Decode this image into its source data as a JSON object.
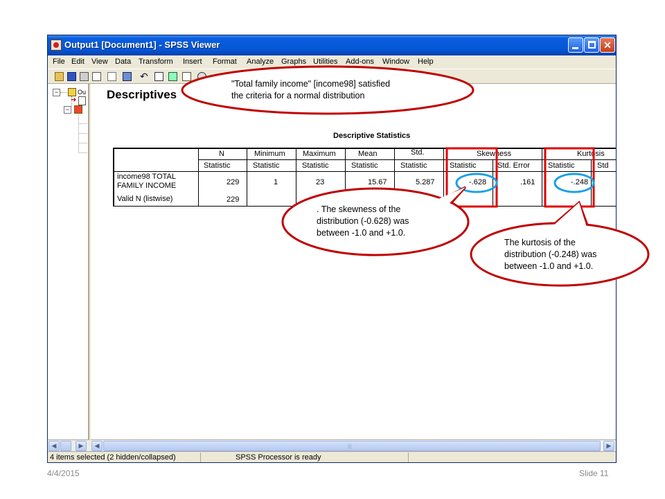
{
  "window": {
    "title": "Output1 [Document1] - SPSS Viewer",
    "controls": {
      "minimize": "minimize",
      "maximize": "maximize",
      "close": "close"
    }
  },
  "menu": [
    "File",
    "Edit",
    "View",
    "Data",
    "Transform",
    "Insert",
    "Format",
    "Analyze",
    "Graphs",
    "Utilities",
    "Add-ons",
    "Window",
    "Help"
  ],
  "toolbar_icons": [
    "open-icon",
    "save-icon",
    "print-icon",
    "print-preview-icon",
    "export-icon",
    "goto-data-icon",
    "undo-icon",
    "grid-icon",
    "chart-icon",
    "variables-icon",
    "find-icon"
  ],
  "outline": {
    "root_label": "Ou"
  },
  "heading": "Descriptives",
  "table": {
    "title": "Descriptive Statistics",
    "group_headers": {
      "n": "N",
      "minimum": "Minimum",
      "maximum": "Maximum",
      "mean": "Mean",
      "std": "Std.",
      "skewness": "Skewness",
      "kurtosis": "Kurtosis"
    },
    "sub_headers": [
      "Statistic",
      "Statistic",
      "Statistic",
      "Statistic",
      "Statistic",
      "Statistic",
      "Std. Error",
      "Statistic",
      "Std"
    ],
    "rows": [
      {
        "label_line1": "income98  TOTAL",
        "label_line2": "FAMILY INCOME",
        "n": "229",
        "minimum": "1",
        "maximum": "23",
        "mean": "15.67",
        "std": "5.287",
        "skew_stat": "-.628",
        "skew_se": ".161",
        "kurt_stat": "-.248"
      },
      {
        "label_line1": "Valid N (listwise)",
        "n": "229"
      }
    ]
  },
  "callouts": {
    "normal": {
      "line1": "\"Total family income\" [income98] satisfied",
      "line2": "the criteria for a normal distribution"
    },
    "skewness": {
      "line1": ". The skewness  of the",
      "line2": "distribution (-0.628) was",
      "line3": "between -1.0 and +1.0."
    },
    "kurtosis": {
      "line1": "The kurtosis of the",
      "line2": "distribution (-0.248) was",
      "line3": "between -1.0 and +1.0."
    }
  },
  "status": {
    "selection": "4 items selected (2 hidden/collapsed)",
    "processor": "SPSS Processor  is ready"
  },
  "footer": {
    "date": "4/4/2015",
    "slide": "Slide 11"
  },
  "colors": {
    "titlebar": "#0457d6",
    "callout_border": "#c00000",
    "callout_fill": "#ffffff",
    "highlight_box": "#e00000",
    "highlight_ellipse": "#1aa0e6"
  }
}
